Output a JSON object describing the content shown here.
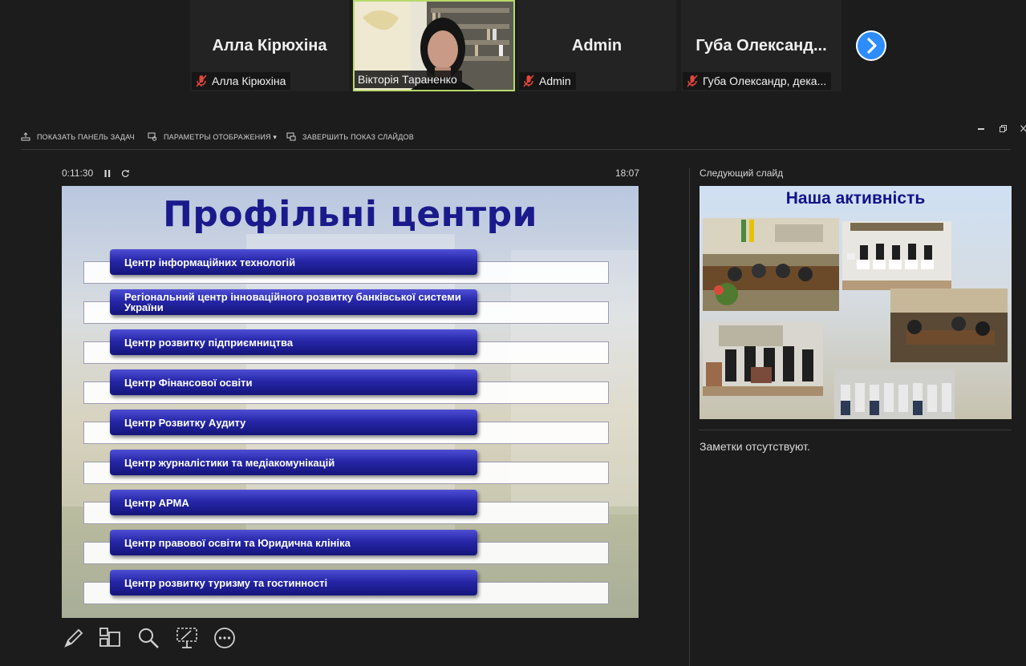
{
  "participants": [
    {
      "display_name": "Алла Кірюхіна",
      "label": "Алла Кірюхіна",
      "muted": true
    },
    {
      "display_name": "",
      "label": "Вікторія Тараненко",
      "muted": false,
      "video": true
    },
    {
      "display_name": "Admin",
      "label": "Admin",
      "muted": true
    },
    {
      "display_name": "Губа Олександ...",
      "label": "Губа Олександр, дека...",
      "muted": true
    }
  ],
  "next_page_icon": "chevron-right-icon",
  "toolbar": {
    "taskbar_label": "ПОКАЗАТЬ ПАНЕЛЬ ЗАДАЧ",
    "display_settings_label": "ПАРАМЕТРЫ ОТОБРАЖЕНИЯ ▾",
    "end_show_label": "ЗАВЕРШИТЬ ПОКАЗ СЛАЙДОВ"
  },
  "presenter": {
    "elapsed": "0:11:30",
    "clock": "18:07",
    "next_slide_label": "Следующий слайд",
    "notes": "Заметки отсутствуют."
  },
  "slide": {
    "title": "Профільні центри",
    "items": [
      "Центр інформаційних технологій",
      "Регіональний центр інноваційного розвитку банківської системи України",
      "Центр розвитку підприємництва",
      "Центр Фінансової освіти",
      "Центр Розвитку Аудиту",
      "Центр журналістики та медіакомунікацій",
      "Центр АРМА",
      "Центр правової освіти та Юридична клініка",
      "Центр розвитку туризму та гостинності"
    ]
  },
  "next_slide": {
    "title": "Наша активність"
  },
  "colors": {
    "accent": "#2d8cff",
    "slide_title": "#1a1a8c",
    "bar": "#2626a8",
    "muted_icon": "#e0463a",
    "active_speaker": "#b8d96b"
  },
  "tools": [
    "pen-icon",
    "slides-grid-icon",
    "zoom-icon",
    "screen-pointer-icon",
    "more-icon"
  ]
}
